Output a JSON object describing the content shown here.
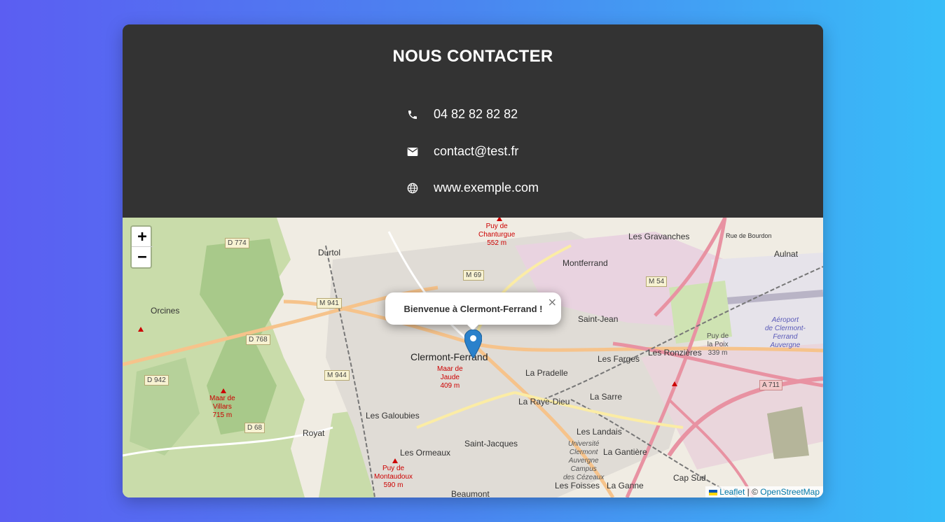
{
  "contact": {
    "title": "NOUS CONTACTER",
    "phone": "04 82 82 82 82",
    "email": "contact@test.fr",
    "website": "www.exemple.com"
  },
  "map": {
    "zoom_in": "+",
    "zoom_out": "−",
    "popup_text": "Bienvenue à Clermont-Ferrand !",
    "popup_close": "×",
    "attribution": {
      "leaflet": "Leaflet",
      "separator": " | © ",
      "osm": "OpenStreetMap"
    },
    "places": {
      "clermont": "Clermont-Ferrand",
      "durtol": "Durtol",
      "montferrand": "Montferrand",
      "gravanches": "Les Gravanches",
      "aulnat": "Aulnat",
      "saint_jean": "Saint-Jean",
      "les_farges": "Les Farges",
      "ronzieres": "Les Ronzières",
      "pradelle": "La Pradelle",
      "raye_dieu": "La Raye-Dieu",
      "la_sarre": "La Sarre",
      "galoubies": "Les Galoubies",
      "royat": "Royat",
      "landais": "Les Landais",
      "saint_jacques": "Saint-Jacques",
      "ormeaux": "Les Ormeaux",
      "gantiere": "La Gantière",
      "cap_sud": "Cap Sud",
      "foisses": "Les Foisses",
      "la_ganne": "La Ganne",
      "beaumont": "Beaumont",
      "orcines": "Orcines",
      "rue_bourdon": "Rue de Bourdon"
    },
    "peaks": {
      "chanturgue": "Puy de\nChanturgue\n552 m",
      "jaude": "Maar de\nJaude\n409 m",
      "villars": "Maar de\nVillars\n715 m",
      "montaudoux": "Puy de\nMontaudoux\n590 m",
      "la_poix": "Puy de\nla Poix\n339 m"
    },
    "airport": "Aéroport\nde Clermont-\nFerrand\nAuvergne",
    "campus": "Université\nClermont\nAuvergne\nCampus\ndes Cézeaux",
    "roads": {
      "d774": "D 774",
      "m69": "M 69",
      "m941": "M 941",
      "m54": "M 54",
      "d768": "D 768",
      "d942": "D 942",
      "m944": "M 944",
      "d68": "D 68",
      "a711": "A 711"
    }
  }
}
